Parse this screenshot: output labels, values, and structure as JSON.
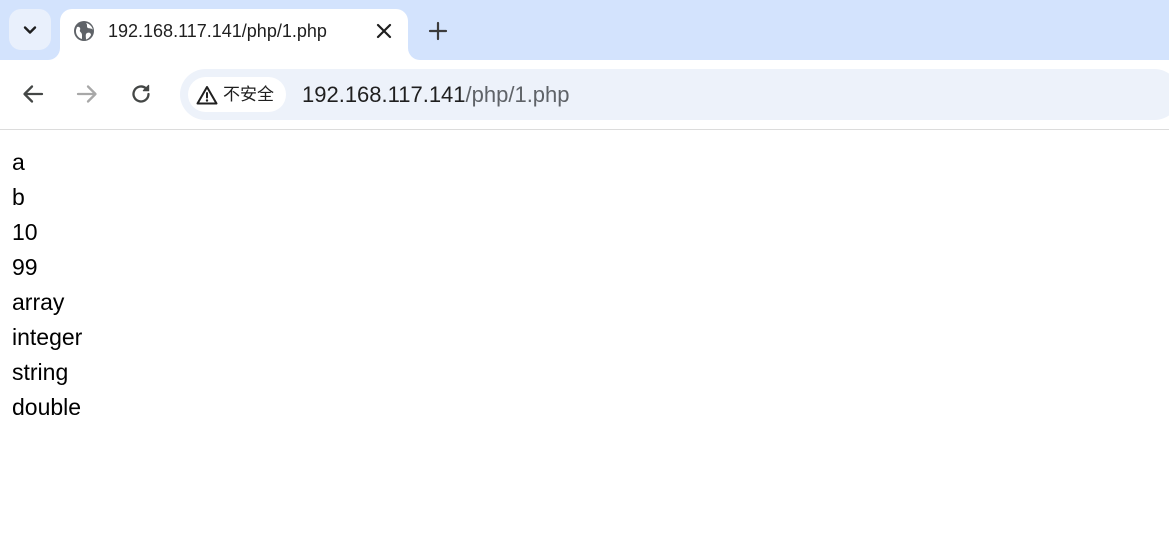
{
  "tabstrip": {
    "tab_search_icon": "chevron-down-icon",
    "active_tab": {
      "favicon": "globe-icon",
      "title": "192.168.117.141/php/1.php",
      "close_icon": "close-icon"
    },
    "new_tab_icon": "plus-icon"
  },
  "toolbar": {
    "back_icon": "arrow-left-icon",
    "forward_icon": "arrow-right-icon",
    "reload_icon": "reload-icon",
    "security": {
      "icon": "warning-icon",
      "label": "不安全"
    },
    "url": {
      "host": "192.168.117.141",
      "path": "/php/1.php"
    }
  },
  "page": {
    "lines": [
      "a",
      "b",
      "10",
      "99",
      "array",
      "integer",
      "string",
      "double"
    ]
  },
  "colors": {
    "tabstrip_bg": "#d3e3fd",
    "omnibox_bg": "#edf2fa",
    "icon": "#444746"
  }
}
